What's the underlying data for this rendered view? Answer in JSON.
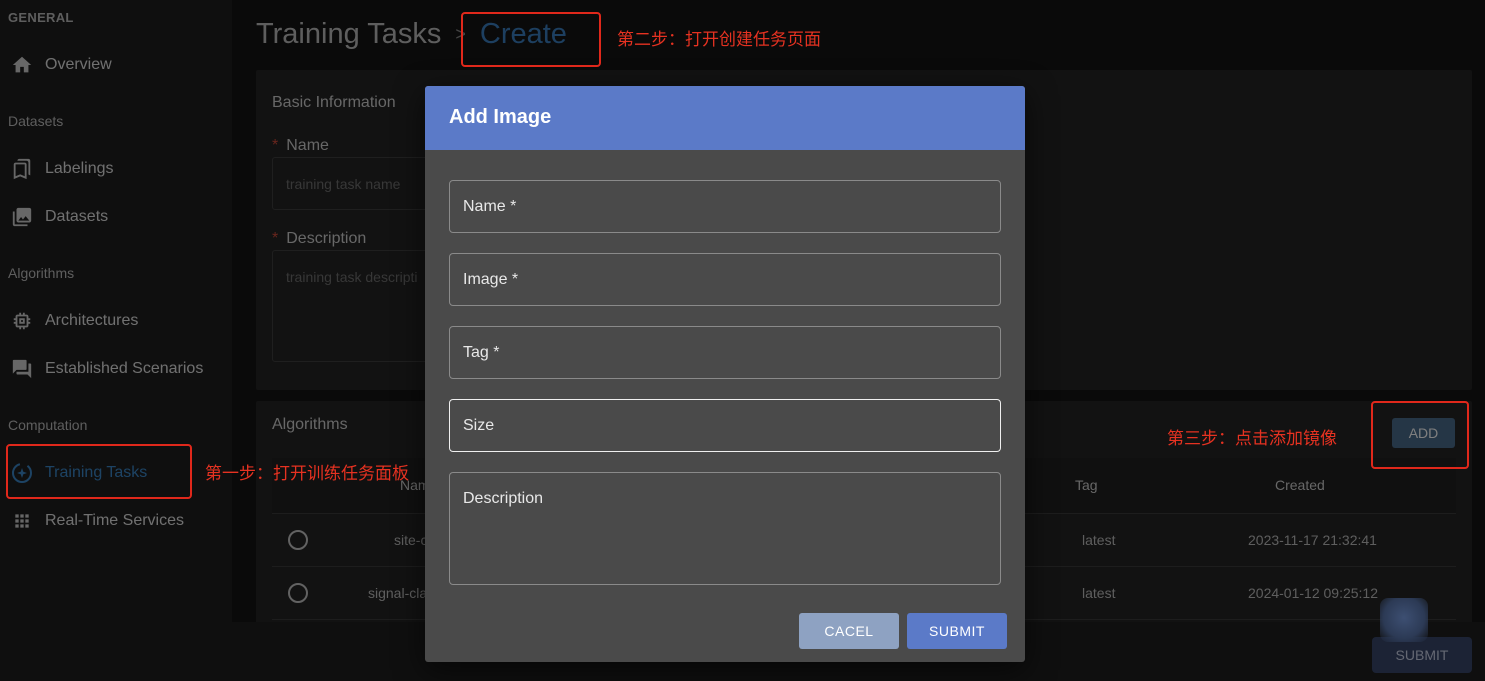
{
  "sidebar": {
    "sections": [
      {
        "label": "GENERAL"
      },
      {
        "label": "Datasets"
      },
      {
        "label": "Algorithms"
      },
      {
        "label": "Computation"
      }
    ],
    "items": [
      {
        "label": "Overview",
        "icon": "home-icon"
      },
      {
        "label": "Labelings",
        "icon": "bookmark-icon"
      },
      {
        "label": "Datasets",
        "icon": "image-library-icon"
      },
      {
        "label": "Architectures",
        "icon": "chip-icon"
      },
      {
        "label": "Established Scenarios",
        "icon": "chat-icon"
      },
      {
        "label": "Training Tasks",
        "icon": "training-icon",
        "active": true
      },
      {
        "label": "Real-Time Services",
        "icon": "grid-icon"
      }
    ]
  },
  "breadcrumb": {
    "parent": "Training Tasks",
    "separator": ">",
    "current": "Create"
  },
  "basic_info": {
    "title": "Basic Information",
    "name_label": "Name",
    "name_placeholder": "training task name",
    "desc_label": "Description",
    "desc_placeholder": "training task descripti",
    "required_mark": "*"
  },
  "algorithms": {
    "title": "Algorithms",
    "add_label": "ADD",
    "columns": {
      "name": "Nam",
      "tag": "Tag",
      "created": "Created"
    },
    "rows": [
      {
        "name": "site-c",
        "tag": "latest",
        "created": "2023-11-17 21:32:41"
      },
      {
        "name": "signal-cla",
        "tag": "latest",
        "created": "2024-01-12 09:25:12"
      }
    ]
  },
  "footer": {
    "submit_label": "SUBMIT"
  },
  "dialog": {
    "title": "Add Image",
    "fields": {
      "name": "Name *",
      "image": "Image *",
      "tag": "Tag *",
      "size": "Size",
      "description": "Description"
    },
    "cancel_label": "CACEL",
    "submit_label": "SUBMIT"
  },
  "annotations": {
    "step1": "第一步：打开训练任务面板",
    "step2": "第二步：打开创建任务页面",
    "step3": "第三步：点击添加镜像"
  },
  "colors": {
    "accent": "#5b7ac8",
    "annotation": "#e0281b",
    "active_nav": "#3a87c9"
  }
}
